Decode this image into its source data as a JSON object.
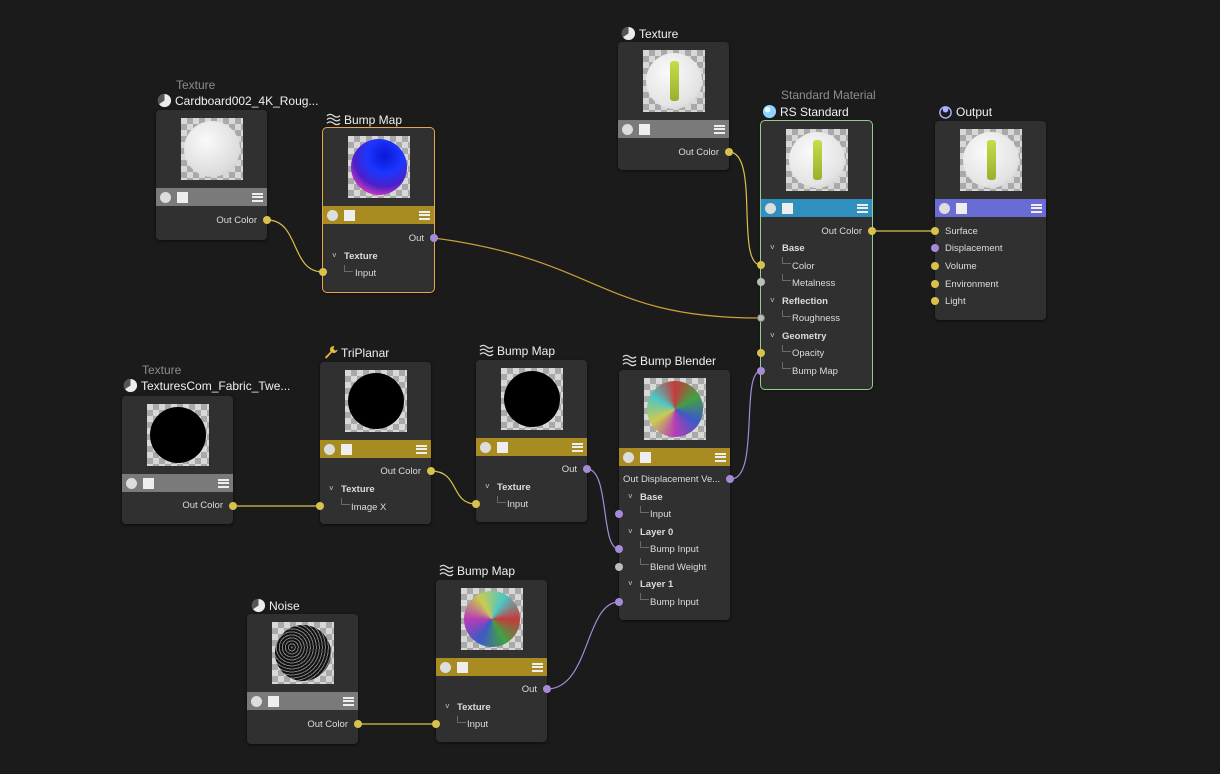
{
  "colors": {
    "yellow_port": "#d8c24c",
    "purple_port": "#a58ad8",
    "gray_port": "#bcbcbc",
    "bar_gray": "#7a7a7a",
    "bar_gold": "#a88c22",
    "bar_blue": "#2f8fbf",
    "bar_violet": "#6b6bd6",
    "select_orange": "#e8a64a",
    "select_green": "#8fd08c"
  },
  "nodes": {
    "tex_cardboard": {
      "subtitle": "Texture",
      "title": "Cardboard002_4K_Roug...",
      "out": "Out Color"
    },
    "bump1": {
      "title": "Bump Map",
      "out": "Out",
      "group": "Texture",
      "input": "Input"
    },
    "tex_top": {
      "title": "Texture",
      "out": "Out Color"
    },
    "rs": {
      "subtitle": "Standard Material",
      "title": "RS Standard",
      "out": "Out Color",
      "base": "Base",
      "color": "Color",
      "metalness": "Metalness",
      "reflection": "Reflection",
      "roughness": "Roughness",
      "geometry": "Geometry",
      "opacity": "Opacity",
      "bump": "Bump Map"
    },
    "output": {
      "title": "Output",
      "surface": "Surface",
      "displacement": "Displacement",
      "volume": "Volume",
      "environment": "Environment",
      "light": "Light"
    },
    "tex_fabric": {
      "subtitle": "Texture",
      "title": "TexturesCom_Fabric_Twe...",
      "out": "Out Color"
    },
    "triplanar": {
      "title": "TriPlanar",
      "out": "Out Color",
      "group": "Texture",
      "input": "Image X"
    },
    "bump2": {
      "title": "Bump Map",
      "out": "Out",
      "group": "Texture",
      "input": "Input"
    },
    "blender": {
      "title": "Bump Blender",
      "out": "Out Displacement Ve...",
      "base": "Base",
      "input": "Input",
      "layer0": "Layer 0",
      "bump_input0": "Bump Input",
      "blend_weight": "Blend Weight",
      "layer1": "Layer 1",
      "bump_input1": "Bump Input"
    },
    "noise": {
      "title": "Noise",
      "out": "Out Color"
    },
    "bump3": {
      "title": "Bump Map",
      "out": "Out",
      "group": "Texture",
      "input": "Input"
    }
  }
}
